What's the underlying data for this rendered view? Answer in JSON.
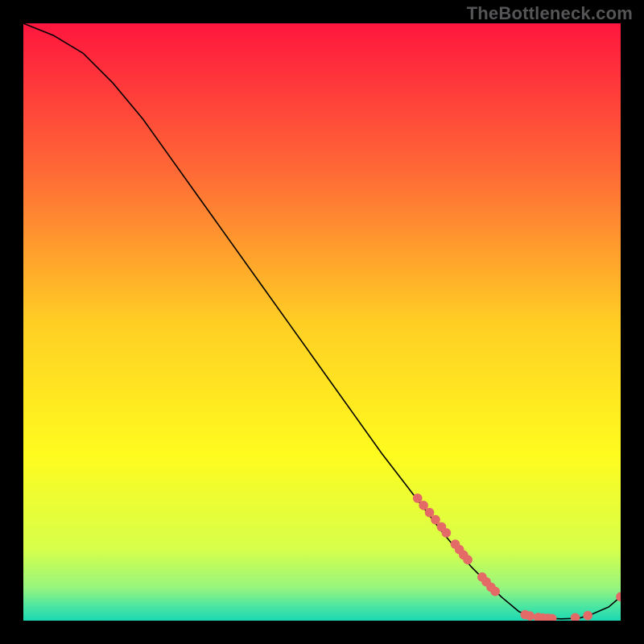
{
  "watermark": "TheBottleneck.com",
  "chart_data": {
    "type": "line",
    "title": "",
    "xlabel": "",
    "ylabel": "",
    "xlim": [
      0,
      100
    ],
    "ylim": [
      0,
      100
    ],
    "grid": false,
    "series": [
      {
        "name": "curve",
        "x": [
          0,
          5,
          10,
          15,
          20,
          25,
          30,
          35,
          40,
          45,
          50,
          55,
          60,
          65,
          70,
          75,
          80,
          83,
          85,
          88,
          90,
          93,
          95,
          98,
          100
        ],
        "y": [
          100,
          98,
          95,
          90,
          84,
          77,
          70,
          63,
          56,
          49,
          42,
          35,
          28,
          21.5,
          15,
          9,
          4,
          1.5,
          0.8,
          0.4,
          0.3,
          0.4,
          1.0,
          2.3,
          4.0
        ]
      }
    ],
    "markers": [
      {
        "x": 66.0,
        "y": 20.5
      },
      {
        "x": 67.0,
        "y": 19.3
      },
      {
        "x": 68.0,
        "y": 18.1
      },
      {
        "x": 69.0,
        "y": 16.9
      },
      {
        "x": 70.0,
        "y": 15.7
      },
      {
        "x": 70.8,
        "y": 14.7
      },
      {
        "x": 72.3,
        "y": 12.8
      },
      {
        "x": 73.0,
        "y": 11.9
      },
      {
        "x": 73.7,
        "y": 11.0
      },
      {
        "x": 74.4,
        "y": 10.2
      },
      {
        "x": 76.8,
        "y": 7.3
      },
      {
        "x": 77.5,
        "y": 6.5
      },
      {
        "x": 78.3,
        "y": 5.6
      },
      {
        "x": 79.0,
        "y": 4.9
      },
      {
        "x": 84.0,
        "y": 1.0
      },
      {
        "x": 84.8,
        "y": 0.8
      },
      {
        "x": 86.2,
        "y": 0.55
      },
      {
        "x": 87.0,
        "y": 0.45
      },
      {
        "x": 87.8,
        "y": 0.4
      },
      {
        "x": 88.5,
        "y": 0.35
      },
      {
        "x": 92.4,
        "y": 0.5
      },
      {
        "x": 94.5,
        "y": 0.85
      },
      {
        "x": 100.0,
        "y": 4.0
      }
    ],
    "marker_color": "#e46a67",
    "line_color": "#000000",
    "gradient_stops": [
      {
        "offset": 0.0,
        "color": "#ff163e"
      },
      {
        "offset": 0.25,
        "color": "#ff6a36"
      },
      {
        "offset": 0.5,
        "color": "#ffce24"
      },
      {
        "offset": 0.72,
        "color": "#fffb1e"
      },
      {
        "offset": 0.88,
        "color": "#d7ff4a"
      },
      {
        "offset": 0.945,
        "color": "#97f57e"
      },
      {
        "offset": 0.975,
        "color": "#4ee6a0"
      },
      {
        "offset": 1.0,
        "color": "#1bd8b4"
      }
    ]
  }
}
